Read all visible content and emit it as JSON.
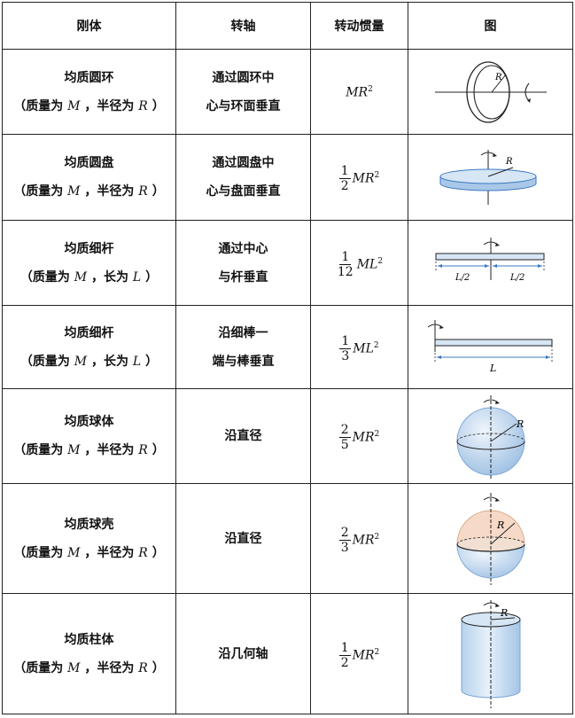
{
  "header": {
    "col1": "刚体",
    "col2": "转轴",
    "col3": "转动惯量",
    "col4": "图"
  },
  "rows": [
    {
      "name": "均质圆环",
      "params": [
        "（质量为",
        "M",
        "，半径为",
        "R",
        "）"
      ],
      "axis": [
        "通过圆环中",
        "心与环面垂直"
      ],
      "numerator": "",
      "denominator": "",
      "expr": "MR",
      "exp": "2",
      "fig_labels": [
        "R"
      ]
    },
    {
      "name": "均质圆盘",
      "params": [
        "（质量为",
        "M",
        "，半径为",
        "R",
        "）"
      ],
      "axis": [
        "通过圆盘中",
        "心与盘面垂直"
      ],
      "numerator": "1",
      "denominator": "2",
      "expr": "MR",
      "exp": "2",
      "fig_labels": [
        "R"
      ]
    },
    {
      "name": "均质细杆",
      "params": [
        "（质量为",
        "M",
        "，长为",
        "L",
        "）"
      ],
      "axis": [
        "通过中心",
        "与杆垂直"
      ],
      "numerator": "1",
      "denominator": "12",
      "expr": "ML",
      "exp": "2",
      "fig_labels": [
        "L/2",
        "L/2"
      ]
    },
    {
      "name": "均质细杆",
      "params": [
        "（质量为",
        "M",
        "，长为",
        "L",
        "）"
      ],
      "axis": [
        "沿细棒一",
        "端与棒垂直"
      ],
      "numerator": "1",
      "denominator": "3",
      "expr": "ML",
      "exp": "2",
      "fig_labels": [
        "L"
      ]
    },
    {
      "name": "均质球体",
      "params": [
        "（质量为",
        "M",
        "，半径为",
        "R",
        "）"
      ],
      "axis": [
        "沿直径"
      ],
      "numerator": "2",
      "denominator": "5",
      "expr": "MR",
      "exp": "2",
      "fig_labels": [
        "R"
      ]
    },
    {
      "name": "均质球壳",
      "params": [
        "（质量为",
        "M",
        "，半径为",
        "R",
        "）"
      ],
      "axis": [
        "沿直径"
      ],
      "numerator": "2",
      "denominator": "3",
      "expr": "MR",
      "exp": "2",
      "fig_labels": [
        "R"
      ]
    },
    {
      "name": "均质柱体",
      "params": [
        "（质量为",
        "M",
        "，半径为",
        "R",
        "）"
      ],
      "axis": [
        "沿几何轴"
      ],
      "numerator": "1",
      "denominator": "2",
      "expr": "MR",
      "exp": "2",
      "fig_labels": [
        "R"
      ]
    }
  ],
  "colors": {
    "fill_light_blue": "#d6e6f5",
    "fill_blue_mid": "#a9c8e8",
    "fill_peach": "#f6d9c6",
    "arrow_blue": "#3b78c4",
    "line": "#222222"
  }
}
